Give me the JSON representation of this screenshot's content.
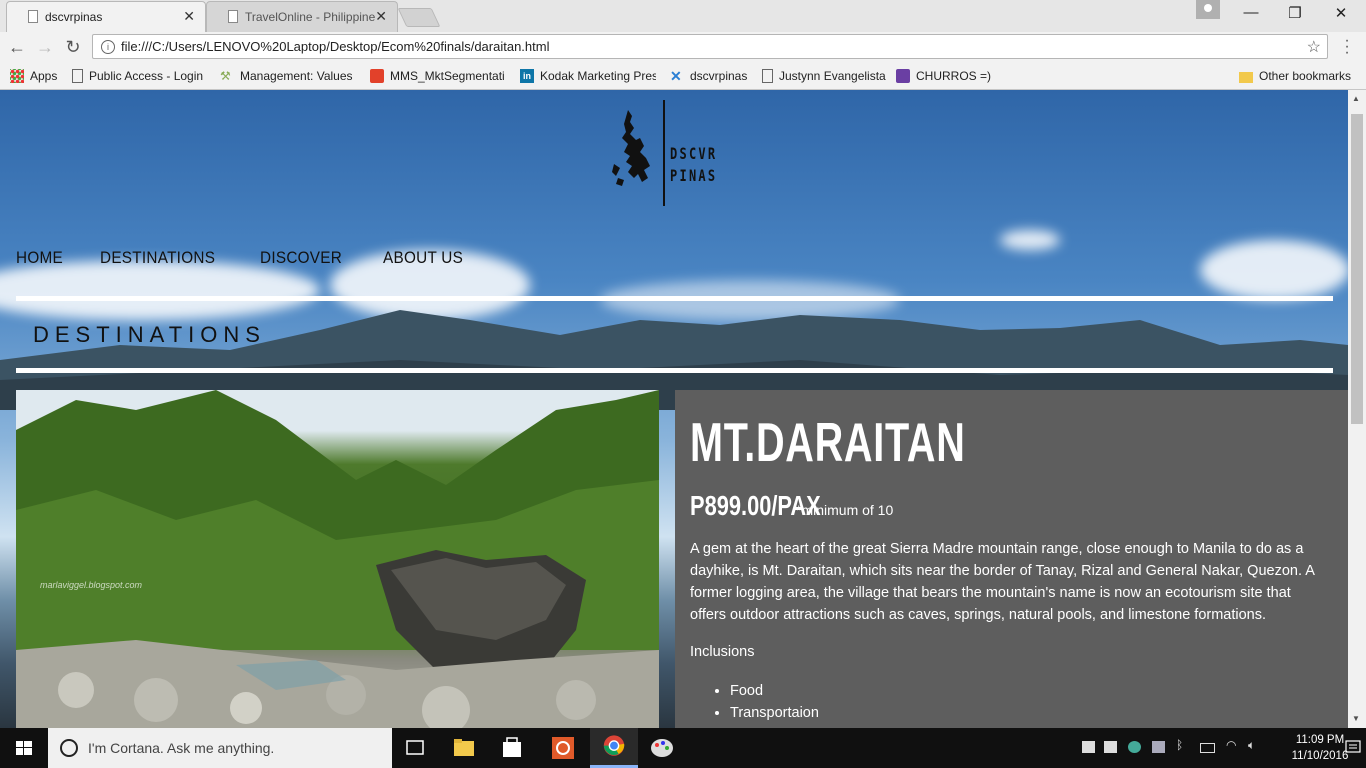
{
  "browser": {
    "tabs": [
      {
        "title": "dscvrpinas",
        "active": true
      },
      {
        "title": "TravelOnline - Philippine",
        "active": false
      }
    ],
    "url": "file:///C:/Users/LENOVO%20Laptop/Desktop/Ecom%20finals/daraitan.html",
    "bookmarks": [
      {
        "label": "Apps",
        "icon": "apps-grid-icon"
      },
      {
        "label": "Public Access - Login",
        "icon": "page-icon"
      },
      {
        "label": "Management: Values (",
        "icon": "pickaxe-icon"
      },
      {
        "label": "MMS_MktSegmentatio",
        "icon": "red-app-icon"
      },
      {
        "label": "Kodak Marketing Pres",
        "icon": "linkedin-icon"
      },
      {
        "label": "dscvrpinas",
        "icon": "blue-x-icon"
      },
      {
        "label": "Justynn Evangelista",
        "icon": "page-icon"
      },
      {
        "label": "CHURROS =)",
        "icon": "purple-form-icon"
      }
    ],
    "other_bookmarks": "Other bookmarks"
  },
  "site": {
    "logo_line1": "DSCVR",
    "logo_line2": "PINAS",
    "nav": [
      "HOME",
      "DESTINATIONS",
      "DISCOVER",
      "ABOUT US"
    ],
    "section_heading": "DESTINATIONS",
    "photo_watermark": "marlaviggel.blogspot.com"
  },
  "destination": {
    "title": "MT.DARAITAN",
    "price": "P899.00/PAX",
    "price_note": "*minimum of 10",
    "description": "A gem at the heart of the great Sierra Madre mountain range, close enough to Manila to do as a dayhike, is Mt. Daraitan, which sits near the border of Tanay, Rizal and General Nakar, Quezon. A former logging area, the village that bears the mountain's name is now an ecotourism site that offers outdoor attractions such as caves, springs, natural pools, and limestone formations.",
    "inclusions_label": "Inclusions",
    "inclusions": [
      "Food",
      "Transportaion"
    ]
  },
  "taskbar": {
    "search_placeholder": "I'm Cortana. Ask me anything.",
    "time": "11:09 PM",
    "date": "11/10/2016"
  },
  "colors": {
    "panel_bg": "#5e5e5e",
    "taskbar_bg": "#101010"
  }
}
